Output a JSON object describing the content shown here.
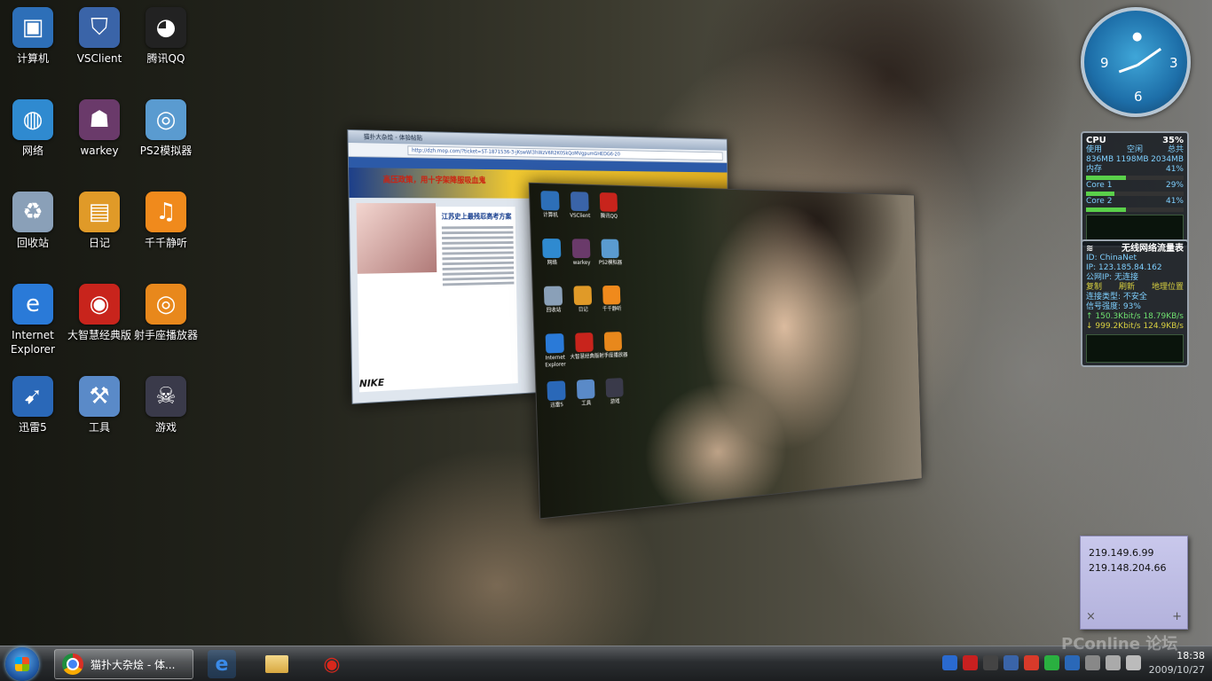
{
  "desktop_icons": [
    {
      "label": "计算机",
      "icon": "computer-icon",
      "color": "#2d6fb8"
    },
    {
      "label": "VSClient",
      "icon": "vsclient-shield-icon",
      "color": "#3a64a8"
    },
    {
      "label": "腾讯QQ",
      "icon": "qq-penguin-icon",
      "color": "#222222"
    },
    {
      "label": "网络",
      "icon": "network-globe-icon",
      "color": "#2f8ad0"
    },
    {
      "label": "warkey",
      "icon": "warkey-icon",
      "color": "#6a3a6a"
    },
    {
      "label": "PS2模拟器",
      "icon": "ps2-emulator-icon",
      "color": "#5a9bd0"
    },
    {
      "label": "回收站",
      "icon": "recycle-bin-icon",
      "color": "#8aa0b8"
    },
    {
      "label": "日记",
      "icon": "diary-icon",
      "color": "#e09a28"
    },
    {
      "label": "千千静听",
      "icon": "ttplayer-icon",
      "color": "#f08a1c"
    },
    {
      "label": "Internet Explorer",
      "icon": "internet-explorer-icon",
      "color": "#2a7ad8"
    },
    {
      "label": "大智慧经典版",
      "icon": "dazhihui-icon",
      "color": "#c8241c"
    },
    {
      "label": "射手座播放器",
      "icon": "splayer-icon",
      "color": "#e8881c"
    },
    {
      "label": "迅雷5",
      "icon": "thunder-icon",
      "color": "#2a68b8"
    },
    {
      "label": "工具",
      "icon": "tools-icon",
      "color": "#5a8ac8"
    },
    {
      "label": "游戏",
      "icon": "game-icon",
      "color": "#3a3a4a"
    }
  ],
  "browser_window": {
    "title": "猫扑大杂烩 - 体验帖贴",
    "url": "http://dzh.mop.com/?ticket=ST-1871536-3-jKswWl3hWzV6R2K0SkQoMVgpumGHEDG6-20",
    "banner": "高压政策，用十字架降服吸血鬼",
    "headline": "江苏史上最残忍高考方案",
    "ad": "NIKE"
  },
  "preview_icons": [
    {
      "label": "计算机",
      "color": "#2d6fb8"
    },
    {
      "label": "VSClient",
      "color": "#3a64a8"
    },
    {
      "label": "腾讯QQ",
      "color": "#c8241c"
    },
    {
      "label": "网络",
      "color": "#2f8ad0"
    },
    {
      "label": "warkey",
      "color": "#6a3a6a"
    },
    {
      "label": "PS2模拟器",
      "color": "#5a9bd0"
    },
    {
      "label": "回收站",
      "color": "#8aa0b8"
    },
    {
      "label": "日记",
      "color": "#e09a28"
    },
    {
      "label": "千千静听",
      "color": "#f08a1c"
    },
    {
      "label": "Internet Explorer",
      "color": "#2a7ad8"
    },
    {
      "label": "大智慧经典版",
      "color": "#c8241c"
    },
    {
      "label": "射手座播放器",
      "color": "#e8881c"
    },
    {
      "label": "迅雷5",
      "color": "#2a68b8"
    },
    {
      "label": "工具",
      "color": "#5a8ac8"
    },
    {
      "label": "游戏",
      "color": "#3a3a4a"
    }
  ],
  "clock_gadget": {
    "numbers": [
      "9",
      "3",
      "6"
    ]
  },
  "cpu_gadget": {
    "title": "CPU",
    "percent": "35%",
    "labels": [
      "使用",
      "空闲",
      "总共"
    ],
    "values": [
      "836MB",
      "1198MB",
      "2034MB"
    ],
    "memory_label": "内存",
    "memory_pct": "41%",
    "core1_label": "Core 1",
    "core1_pct": "29%",
    "core2_label": "Core 2",
    "core2_pct": "41%",
    "memory_fill": 0.41,
    "core1_fill": 0.29,
    "core2_fill": 0.41
  },
  "network_gadget": {
    "title": "无线网络流量表",
    "id": "ID: ChinaNet",
    "ip": "IP: 123.185.84.162",
    "public_ip": "公网IP: 无连接",
    "actions": [
      "复制",
      "刷新",
      "地理位置"
    ],
    "conn_type": "连接类型:     不安全",
    "signal": "信号强度: 93%",
    "up_rate": "150.3Kbit/s",
    "up_bytes": "18.79KB/s",
    "down_rate": "999.2Kbit/s",
    "down_bytes": "124.9KB/s"
  },
  "sticky_note": {
    "line1": "219.149.6.99",
    "line2": "219.148.204.66",
    "close": "×",
    "add": "+"
  },
  "taskbar": {
    "active_task": "猫扑大杂烩 - 体...",
    "time": "18:38",
    "date": "2009/10/27"
  },
  "watermark": "PConline 论坛"
}
